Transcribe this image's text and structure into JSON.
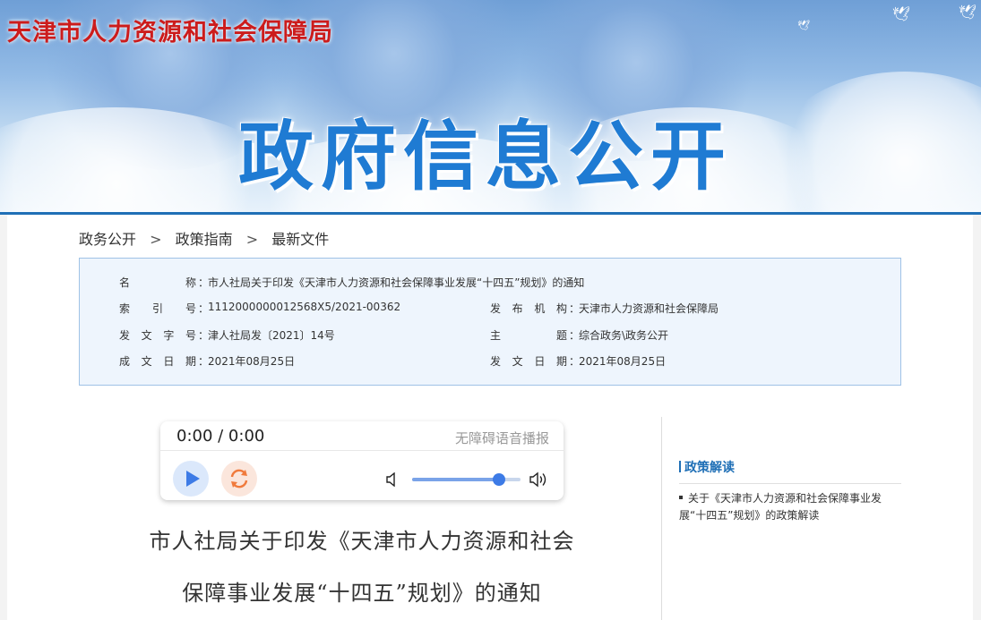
{
  "header": {
    "org_name": "天津市人力资源和社会保障局",
    "section_title": "政府信息公开"
  },
  "breadcrumb": {
    "items": [
      "政务公开",
      "政策指南",
      "最新文件"
    ],
    "separator": ">"
  },
  "info": {
    "name_label": "名称",
    "name_value": "市人社局关于印发《天津市人力资源和社会保障事业发展“十四五”规划》的通知",
    "index_label": "索引号",
    "index_value": "1112000000012568X5/2021-00362",
    "publisher_label": "发布机构",
    "publisher_value": "天津市人力资源和社会保障局",
    "docno_label": "发文字号",
    "docno_value": "津人社局发〔2021〕14号",
    "topic_label": "主题",
    "topic_value": "综合政务\\政务公开",
    "created_label": "成文日期",
    "created_value": "2021年08月25日",
    "issued_label": "发文日期",
    "issued_value": "2021年08月25日",
    "colon": "："
  },
  "player": {
    "time": "0:00 / 0:00",
    "label": "无障碍语音播报",
    "volume_level": 0.8
  },
  "article": {
    "title_line1": "市人社局关于印发《天津市人力资源和社会",
    "title_line2": "保障事业发展“十四五”规划》的通知"
  },
  "sidebar": {
    "heading": "政策解读",
    "items": [
      {
        "label": "关于《天津市人力资源和社会保障事业发展“十四五”规划》的政策解读"
      }
    ]
  },
  "colors": {
    "org_red": "#cc1c1c",
    "title_blue": "#1f7bd3",
    "accent_blue": "#1f6fb6",
    "info_bg": "#eef5fd"
  }
}
